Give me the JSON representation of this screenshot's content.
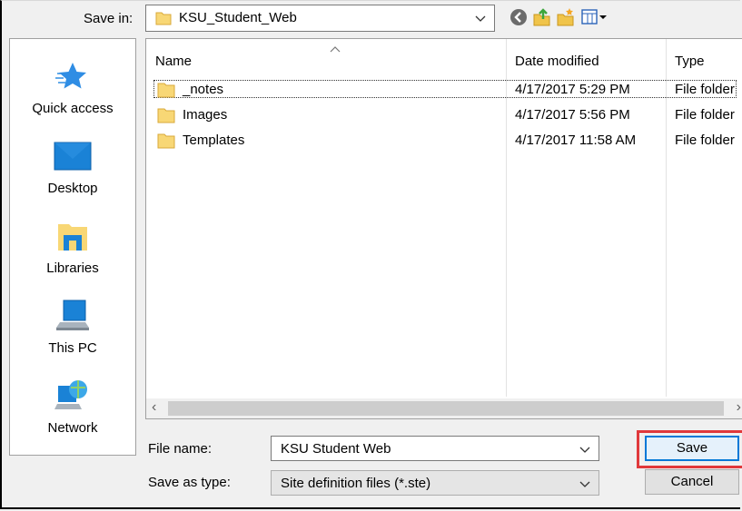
{
  "save_in": {
    "label": "Save in:",
    "value": "KSU_Student_Web"
  },
  "toolbar": [
    "back-icon",
    "up-folder-icon",
    "new-folder-icon",
    "view-menu-icon"
  ],
  "places": [
    {
      "label": "Quick access",
      "icon": "star-icon"
    },
    {
      "label": "Desktop",
      "icon": "desktop-icon"
    },
    {
      "label": "Libraries",
      "icon": "libraries-icon"
    },
    {
      "label": "This PC",
      "icon": "computer-icon"
    },
    {
      "label": "Network",
      "icon": "network-icon"
    }
  ],
  "columns": {
    "name": "Name",
    "date": "Date modified",
    "type": "Type"
  },
  "files": [
    {
      "name": "_notes",
      "date": "4/17/2017 5:29 PM",
      "type": "File folder"
    },
    {
      "name": "Images",
      "date": "4/17/2017 5:56 PM",
      "type": "File folder"
    },
    {
      "name": "Templates",
      "date": "4/17/2017 11:58 AM",
      "type": "File folder"
    }
  ],
  "file_name": {
    "label": "File name:",
    "value": "KSU Student Web"
  },
  "save_as_type": {
    "label": "Save as type:",
    "value": "Site definition files (*.ste)"
  },
  "buttons": {
    "save": "Save",
    "cancel": "Cancel"
  },
  "colors": {
    "accent": "#0078d7",
    "highlight": "#e0383b",
    "folder": "#f8d775"
  }
}
